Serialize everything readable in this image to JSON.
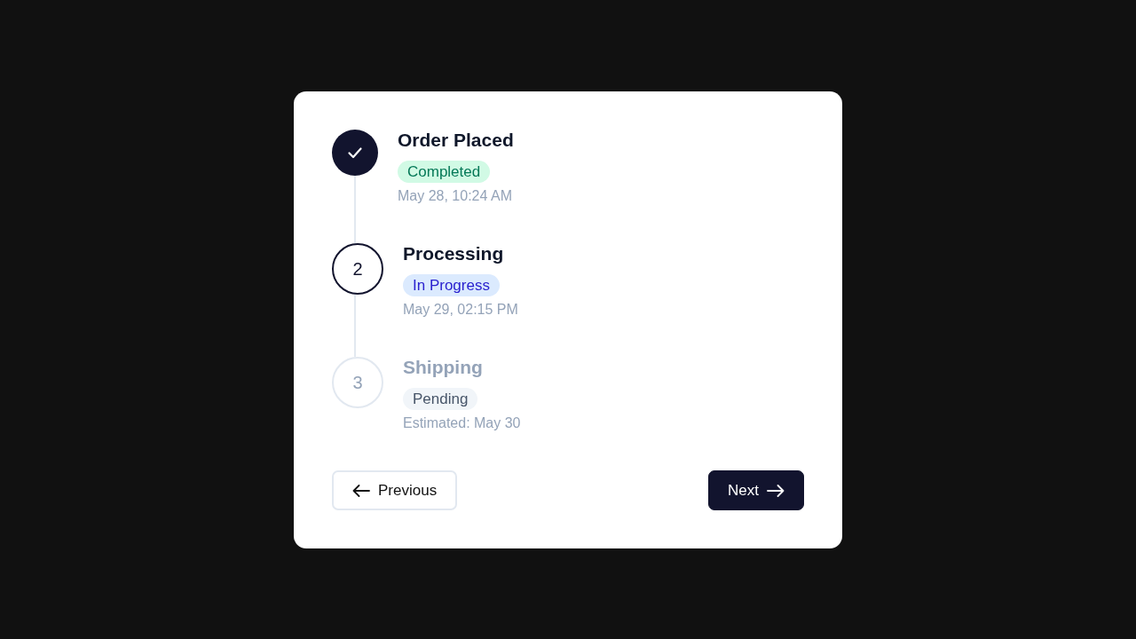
{
  "steps": [
    {
      "title": "Order Placed",
      "kind": "completed",
      "badge": "Completed",
      "date": "May 28, 10:24 AM"
    },
    {
      "title": "Processing",
      "kind": "current",
      "marker": "2",
      "badge": "In Progress",
      "date": "May 29, 02:15 PM"
    },
    {
      "title": "Shipping",
      "kind": "pending",
      "marker": "3",
      "badge": "Pending",
      "date": "Estimated: May 30"
    }
  ],
  "buttons": [
    {
      "label": "Previous",
      "kind": "back"
    },
    {
      "label": "Next",
      "kind": "forward"
    }
  ]
}
